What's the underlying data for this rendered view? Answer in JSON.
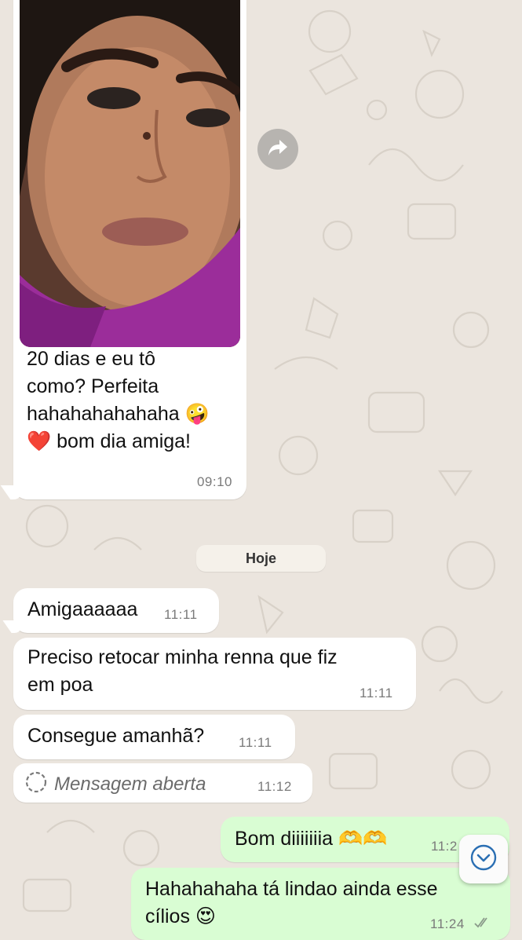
{
  "chat": {
    "media_message": {
      "caption": "20 dias e eu tô\ncomo? Perfeita\nhahahahahahaha 🤪\n❤️ bom dia amiga!",
      "time": "09:10"
    },
    "date_separator": "Hoje",
    "incoming": [
      {
        "text": "Amigaaaaaa",
        "time": "11:11"
      },
      {
        "text": "Preciso retocar minha renna que fiz\nem poa",
        "time": "11:11"
      },
      {
        "text": "Consegue amanhã?",
        "time": "11:11"
      },
      {
        "text": "Mensagem aberta",
        "time": "11:12"
      }
    ],
    "outgoing": [
      {
        "text": "Bom diiiiiiia 🫶🫶",
        "time": "11:2"
      },
      {
        "text": "Hahahahaha tá lindao ainda esse\ncílios 😍",
        "time": "11:24"
      }
    ]
  },
  "icons": {
    "forward": "share-arrow-icon",
    "view_once": "view-once-icon",
    "read_receipt": "double-check-icon",
    "scroll_down": "chevron-down-icon"
  },
  "colors": {
    "wallpaper": "#ebe5de",
    "incoming_bubble": "#ffffff",
    "outgoing_bubble": "#d9fdd3",
    "accent": "#2b6fb3"
  }
}
